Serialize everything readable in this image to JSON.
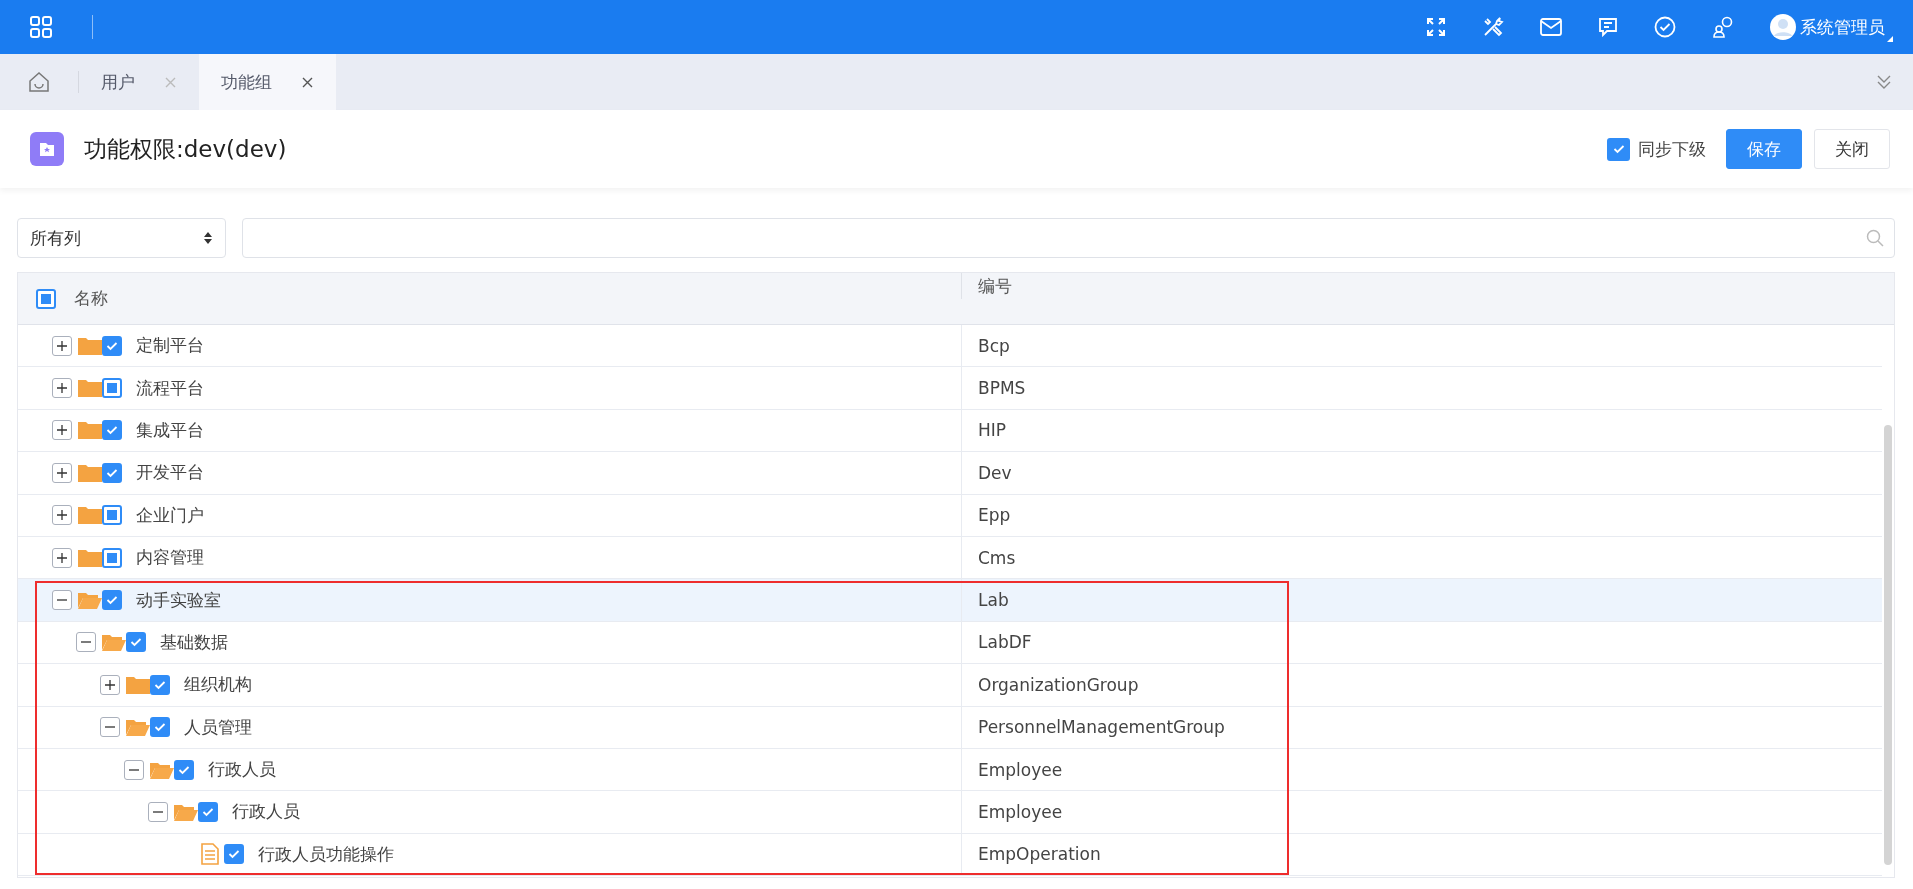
{
  "topbar": {
    "user": "系统管理员"
  },
  "tabs": [
    {
      "label": "用户",
      "selected": false
    },
    {
      "label": "功能组",
      "selected": true
    }
  ],
  "header": {
    "title": "功能权限:dev(dev)",
    "sync": {
      "label": "同步下级",
      "checked": true
    },
    "buttons": [
      {
        "label": "保存",
        "kind": "primary"
      },
      {
        "label": "关闭",
        "kind": "default"
      }
    ]
  },
  "filter": {
    "column_select": "所有列"
  },
  "table": {
    "columns": [
      "名称",
      "编号"
    ],
    "header_indeterminate": true,
    "rows": [
      {
        "name": "定制平台",
        "code": "Bcp",
        "kind": "folder",
        "expanded": false,
        "checked": true,
        "indeterminate": false,
        "selected": false,
        "outlined": false
      },
      {
        "name": "流程平台",
        "code": "BPMS",
        "kind": "folder",
        "expanded": false,
        "checked": false,
        "indeterminate": true,
        "selected": false,
        "outlined": false
      },
      {
        "name": "集成平台",
        "code": "HIP",
        "kind": "folder",
        "expanded": false,
        "checked": true,
        "indeterminate": false,
        "selected": false,
        "outlined": false
      },
      {
        "name": "开发平台",
        "code": "Dev",
        "kind": "folder",
        "expanded": false,
        "checked": true,
        "indeterminate": false,
        "selected": false,
        "outlined": false
      },
      {
        "name": "企业门户",
        "code": "Epp",
        "kind": "folder",
        "expanded": false,
        "checked": false,
        "indeterminate": true,
        "selected": false,
        "outlined": false
      },
      {
        "name": "内容管理",
        "code": "Cms",
        "kind": "folder",
        "expanded": false,
        "checked": false,
        "indeterminate": true,
        "selected": false,
        "outlined": false
      },
      {
        "name": "动手实验室",
        "code": "Lab",
        "kind": "folder",
        "expanded": true,
        "checked": true,
        "indeterminate": false,
        "selected": true,
        "outlined": true,
        "children": [
          {
            "name": "基础数据",
            "code": "LabDF",
            "kind": "folder",
            "expanded": true,
            "checked": true,
            "indeterminate": false,
            "selected": false,
            "children": [
              {
                "name": "组织机构",
                "code": "OrganizationGroup",
                "kind": "folder",
                "expanded": false,
                "checked": true,
                "indeterminate": false,
                "selected": false
              },
              {
                "name": "人员管理",
                "code": "PersonnelManagementGroup",
                "kind": "folder",
                "expanded": true,
                "checked": true,
                "indeterminate": false,
                "selected": false,
                "children": [
                  {
                    "name": "行政人员",
                    "code": "Employee",
                    "kind": "folder",
                    "expanded": true,
                    "checked": true,
                    "indeterminate": false,
                    "selected": false,
                    "children": [
                      {
                        "name": "行政人员",
                        "code": "Employee",
                        "kind": "folder",
                        "expanded": true,
                        "checked": true,
                        "indeterminate": false,
                        "selected": false,
                        "children": [
                          {
                            "name": "行政人员功能操作",
                            "code": "EmpOperation",
                            "kind": "document",
                            "checked": true,
                            "indeterminate": false,
                            "selected": false
                          }
                        ]
                      }
                    ]
                  }
                ]
              }
            ]
          }
        ]
      }
    ]
  }
}
